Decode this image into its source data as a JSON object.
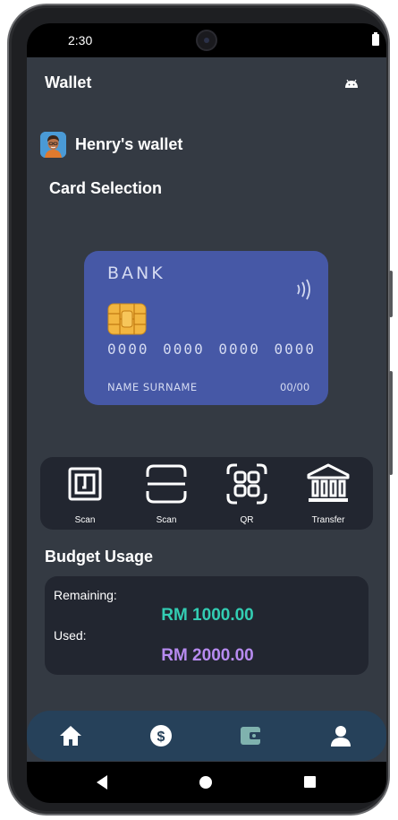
{
  "status_bar": {
    "time": "2:30"
  },
  "app_bar": {
    "title": "Wallet",
    "action_icon": "android-icon"
  },
  "wallet": {
    "name": "Henry's wallet",
    "avatar_icon": "person-avatar"
  },
  "card_section": {
    "title": "Card Selection"
  },
  "card": {
    "bank": "BANK",
    "number": "0000 0000 0000 0000",
    "holder": "NAME SURNAME",
    "expiry": "00/00",
    "color": "#4658a6"
  },
  "actions": [
    {
      "label": "Scan",
      "icon": "nfc-scan-icon"
    },
    {
      "label": "Scan",
      "icon": "scan-frame-icon"
    },
    {
      "label": "QR",
      "icon": "qr-code-icon"
    },
    {
      "label": "Transfer",
      "icon": "bank-building-icon"
    }
  ],
  "budget": {
    "title": "Budget Usage",
    "remaining_label": "Remaining:",
    "remaining_value": "RM 1000.00",
    "remaining_color": "#33cdb3",
    "used_label": "Used:",
    "used_value": "RM 2000.00",
    "used_color": "#b78bf0"
  },
  "bottom_nav": [
    {
      "icon": "home-icon",
      "selected": false
    },
    {
      "icon": "dollar-icon",
      "selected": false
    },
    {
      "icon": "wallet-icon",
      "selected": true
    },
    {
      "icon": "person-icon",
      "selected": false
    }
  ]
}
